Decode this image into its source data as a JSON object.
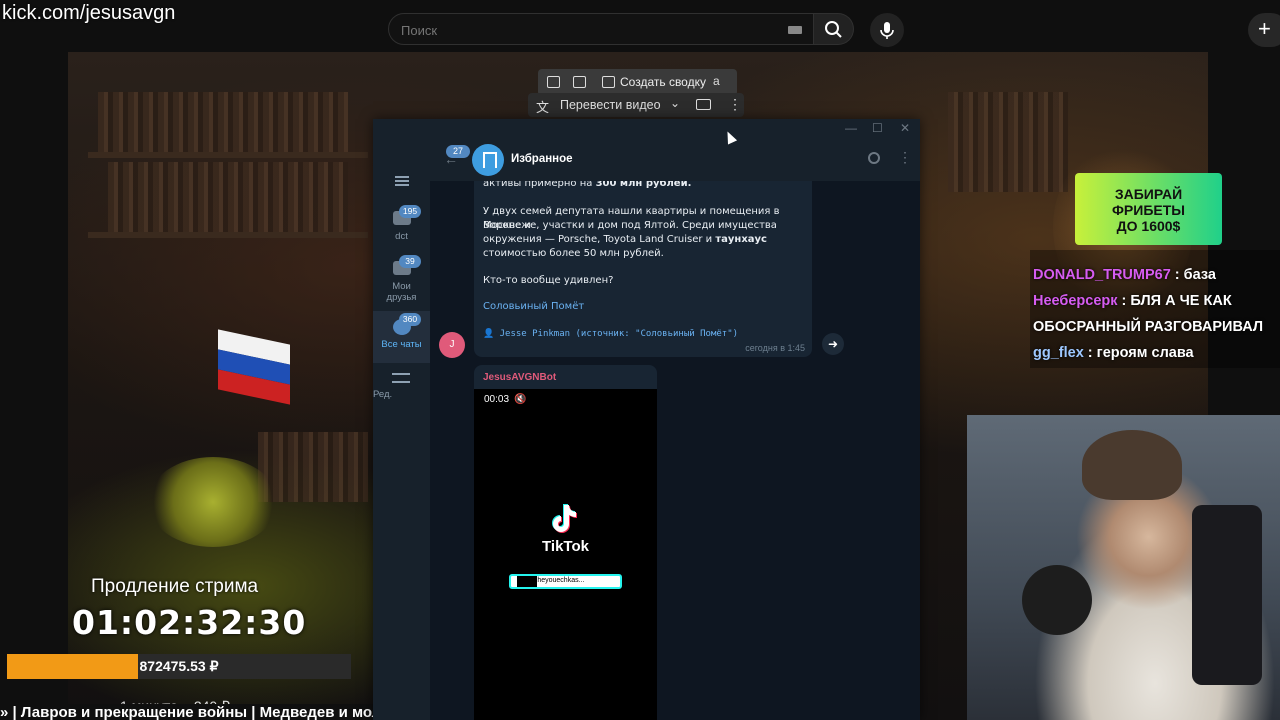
{
  "overlay": {
    "url": "kick.com/jesusavgn"
  },
  "search": {
    "placeholder": "Поиск"
  },
  "browser_popup": {
    "summary_label": "Создать сводку",
    "translate_label": "Перевести видео"
  },
  "stream": {
    "promo": [
      "ЗАБИРАЙ",
      "ФРИБЕТЫ",
      "ДО 1600$"
    ],
    "chat": [
      {
        "nick": "DONALD_TRUMP67",
        "color": "#d65cf0",
        "text": "база"
      },
      {
        "nick": "Нееберсерк",
        "color": "#d65cf0",
        "text": "БЛЯ А ЧЕ КАК"
      },
      {
        "nick": "",
        "color": "#ffffff",
        "text": "ОБОСРАННЫЙ РАЗГОВАРИВАЛ"
      },
      {
        "nick": "gg_flex",
        "color": "#9ec8ff",
        "text": "героям слава"
      }
    ],
    "timer_label": "Продление стрима",
    "timer": "01:02:32:30",
    "donate_value": "872475.53 ₽",
    "donate_progress": 0.38,
    "rate": "1 минута = 240 ₽",
    "ticker": "» | Лавров и прекращение войны | Медведев и мол"
  },
  "telegram": {
    "folders": [
      {
        "label": "dct",
        "badge": "195"
      },
      {
        "label": "Мои друзья",
        "badge": "39"
      },
      {
        "label": "Все чаты",
        "badge": "360"
      },
      {
        "label": "Ред.",
        "badge": ""
      }
    ],
    "back_badge": "27",
    "chat_title": "Избранное",
    "message": {
      "line1_pre": "активы примерно на ",
      "line1_bold": "300 млн рублей.",
      "para2_l1": "У двух семей депутата нашли квартиры и помещения в Москве и",
      "para2_l2": "Воронеже, участки и дом под Ялтой. Среди имущества",
      "para2_l3_pre": "окружения — Porsche, Toyota Land Cruiser и ",
      "para2_l3_bold": "таунхаус",
      "para2_l4": "стоимостью более 50 млн рублей.",
      "question": "Кто-то вообще удивлен?",
      "link": "Соловьиный Помёт",
      "forward": "👤 Jesse Pinkman (источник: \"Соловьиный Помёт\")",
      "time": "сегодня в 1:45",
      "sender_initial": "J"
    },
    "video_message": {
      "sender": "JesusAVGNBot",
      "time": "00:03",
      "brand": "TikTok",
      "handle": "@etozheyouechkas..."
    }
  }
}
